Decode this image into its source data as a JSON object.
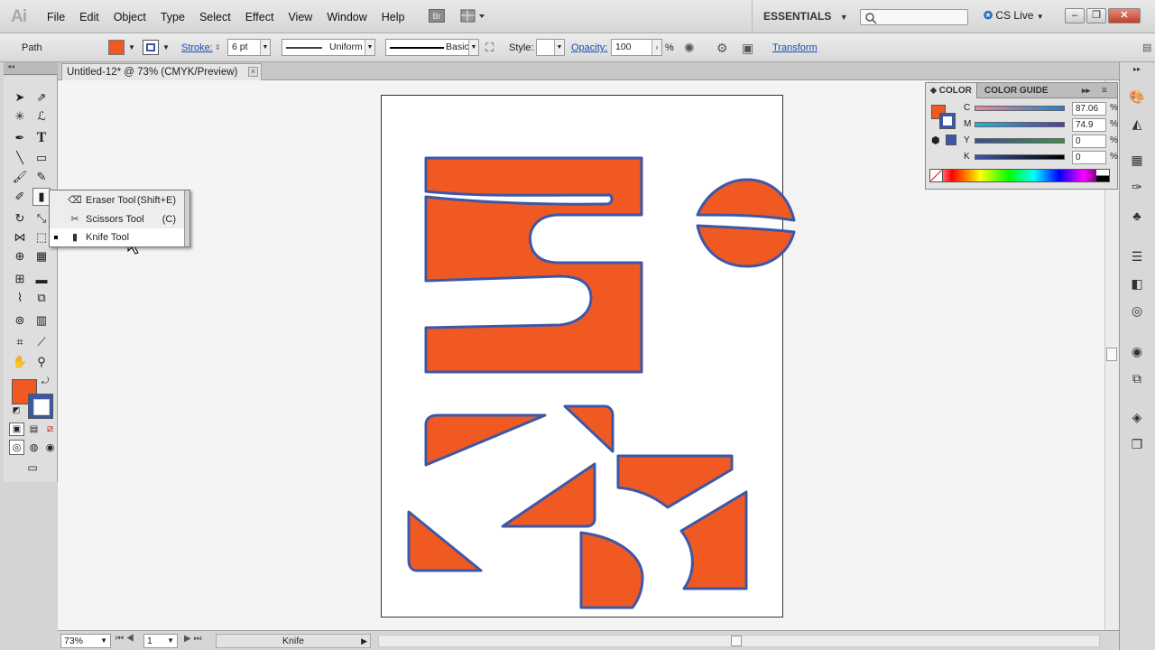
{
  "app": {
    "logo": "Ai"
  },
  "menu": [
    "File",
    "Edit",
    "Object",
    "Type",
    "Select",
    "Effect",
    "View",
    "Window",
    "Help"
  ],
  "bridge_label": "Br",
  "workspace": {
    "name": "ESSENTIALS"
  },
  "cslive": {
    "label": "CS Live"
  },
  "window_buttons": {
    "minimize": "–",
    "restore": "❐",
    "close": "✕"
  },
  "control": {
    "object_type": "Path",
    "stroke_label": "Stroke:",
    "stroke_weight": "6 pt",
    "profile": "Uniform",
    "brush": "Basic",
    "style_label": "Style:",
    "opacity_label": "Opacity:",
    "opacity_value": "100",
    "opacity_unit": "%",
    "transform_label": "Transform",
    "fill_color": "#f05a22",
    "stroke_color": "#3d57a8"
  },
  "document": {
    "tab_title": "Untitled-12* @ 73% (CMYK/Preview)",
    "close_glyph": "×"
  },
  "flyout": {
    "items": [
      {
        "label": "Eraser Tool",
        "shortcut": "(Shift+E)"
      },
      {
        "label": "Scissors Tool",
        "shortcut": "(C)"
      },
      {
        "label": "Knife Tool",
        "shortcut": ""
      }
    ],
    "selected": "Knife Tool"
  },
  "color_panel": {
    "tabs": [
      "COLOR",
      "COLOR GUIDE"
    ],
    "channels": [
      {
        "name": "C",
        "value": "87.06",
        "unit": "%"
      },
      {
        "name": "M",
        "value": "74.9",
        "unit": "%"
      },
      {
        "name": "Y",
        "value": "0",
        "unit": "%"
      },
      {
        "name": "K",
        "value": "0",
        "unit": "%"
      }
    ]
  },
  "status": {
    "zoom": "73%",
    "page": "1",
    "tool": "Knife"
  },
  "colors": {
    "fill": "#f05a22",
    "stroke": "#3d57a8"
  }
}
